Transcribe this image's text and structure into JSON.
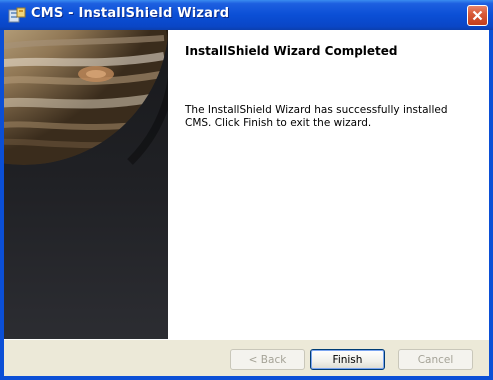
{
  "window": {
    "title": "CMS - InstallShield Wizard",
    "titlebar_color": "#0b4fd6",
    "close_color": "#d85a38"
  },
  "banner": {
    "image": "jupiter-planet-image"
  },
  "content": {
    "heading": "InstallShield Wizard Completed",
    "message": "The InstallShield Wizard has successfully installed CMS. Click Finish to exit the wizard."
  },
  "buttons": {
    "back": "< Back",
    "finish": "Finish",
    "cancel": "Cancel"
  }
}
